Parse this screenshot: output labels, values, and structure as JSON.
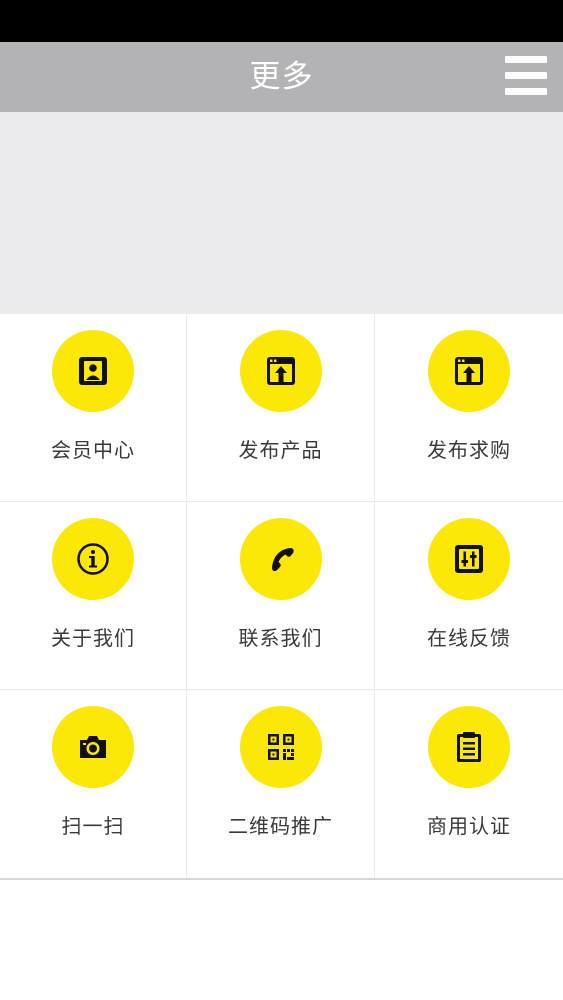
{
  "header": {
    "title": "更多",
    "menu_icon": "hamburger-menu-icon"
  },
  "colors": {
    "status_bar": "#000000",
    "nav_bar": "#b3b3b5",
    "banner": "#ececee",
    "icon_circle": "#fbe806",
    "icon_glyph": "#111111",
    "label_text": "#3a3a3a"
  },
  "grid": {
    "items": [
      {
        "label": "会员中心",
        "icon": "member-center-icon"
      },
      {
        "label": "发布产品",
        "icon": "publish-product-icon"
      },
      {
        "label": "发布求购",
        "icon": "publish-purchase-icon"
      },
      {
        "label": "关于我们",
        "icon": "info-icon"
      },
      {
        "label": "联系我们",
        "icon": "phone-icon"
      },
      {
        "label": "在线反馈",
        "icon": "feedback-icon"
      },
      {
        "label": "扫一扫",
        "icon": "camera-icon"
      },
      {
        "label": "二维码推广",
        "icon": "qr-code-icon"
      },
      {
        "label": "商用认证",
        "icon": "clipboard-icon"
      }
    ]
  }
}
